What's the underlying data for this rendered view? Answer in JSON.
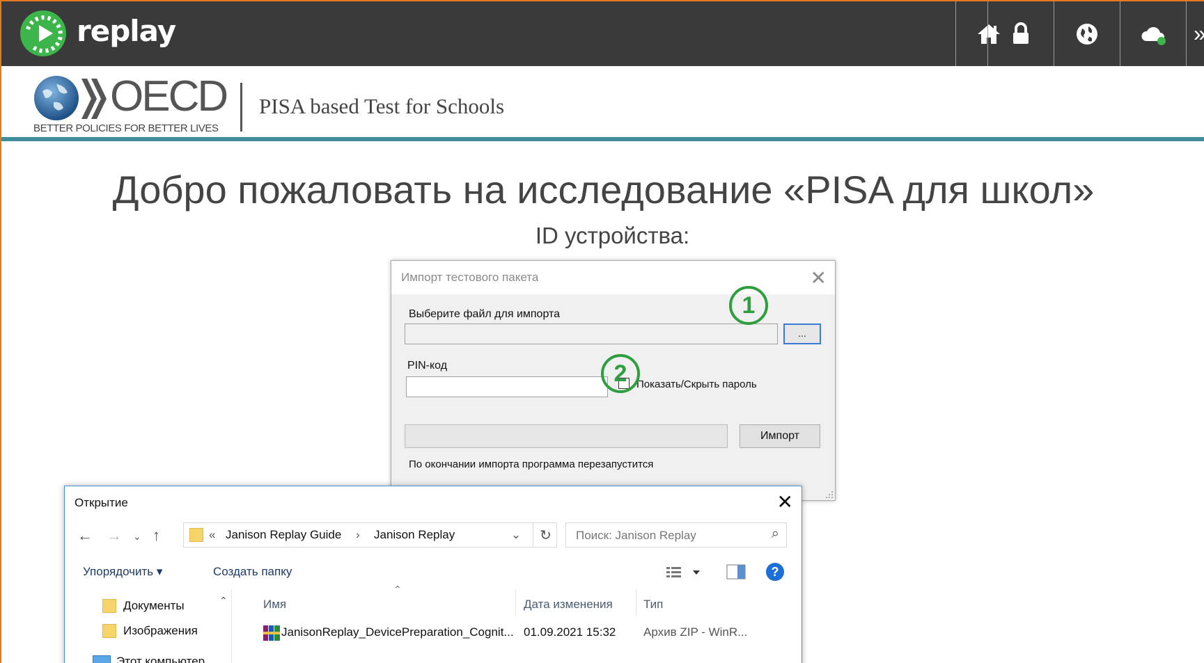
{
  "topbar": {
    "app_name": "replay",
    "buttons": [
      {
        "name": "home",
        "icon": "home-icon"
      },
      {
        "name": "lock",
        "icon": "lock-icon"
      },
      {
        "name": "globe",
        "icon": "globe-icon"
      },
      {
        "name": "cloud",
        "icon": "cloud-status-icon"
      }
    ],
    "overflow_label": "»"
  },
  "header": {
    "org_name": "OECD",
    "org_tagline": "BETTER POLICIES FOR BETTER LIVES",
    "product_title": "PISA based Test for Schools"
  },
  "main": {
    "welcome_title": "Добро пожаловать на исследование «PISA для школ»",
    "device_id_label": "ID устройства:"
  },
  "import_dialog": {
    "title": "Импорт тестового пакета",
    "file_label": "Выберите файл для импорта",
    "file_value": "",
    "browse_label": "...",
    "pin_label": "PIN-код",
    "pin_value": "",
    "show_hide_label": "Показать/Скрыть пароль",
    "show_hide_checked": false,
    "progress_percent": 0,
    "import_button": "Импорт",
    "restart_note": "По окончании импорта программа перезапустится",
    "callouts": [
      "1",
      "2"
    ]
  },
  "open_dialog": {
    "title": "Открытие",
    "address_prefix": "«",
    "breadcrumb": [
      "Janison Replay Guide",
      "Janison Replay"
    ],
    "breadcrumb_sep": "›",
    "search_placeholder": "Поиск: Janison Replay",
    "organize_label": "Упорядочить ▾",
    "new_folder_label": "Создать папку",
    "nav_items": [
      "Документы",
      "Изображения",
      "Этот компьютер"
    ],
    "columns": [
      "Имя",
      "Дата изменения",
      "Тип"
    ],
    "files": [
      {
        "name": "JanisonReplay_DevicePreparation_Cognit...",
        "modified": "01.09.2021 15:32",
        "type": "Архив ZIP - WinR..."
      }
    ]
  },
  "colors": {
    "topbar_bg": "#3a3a3a",
    "brand_green": "#3cb54a",
    "header_rule": "#3e8e99",
    "callout_green": "#2e9e3f",
    "frame_orange": "#e07b22"
  }
}
